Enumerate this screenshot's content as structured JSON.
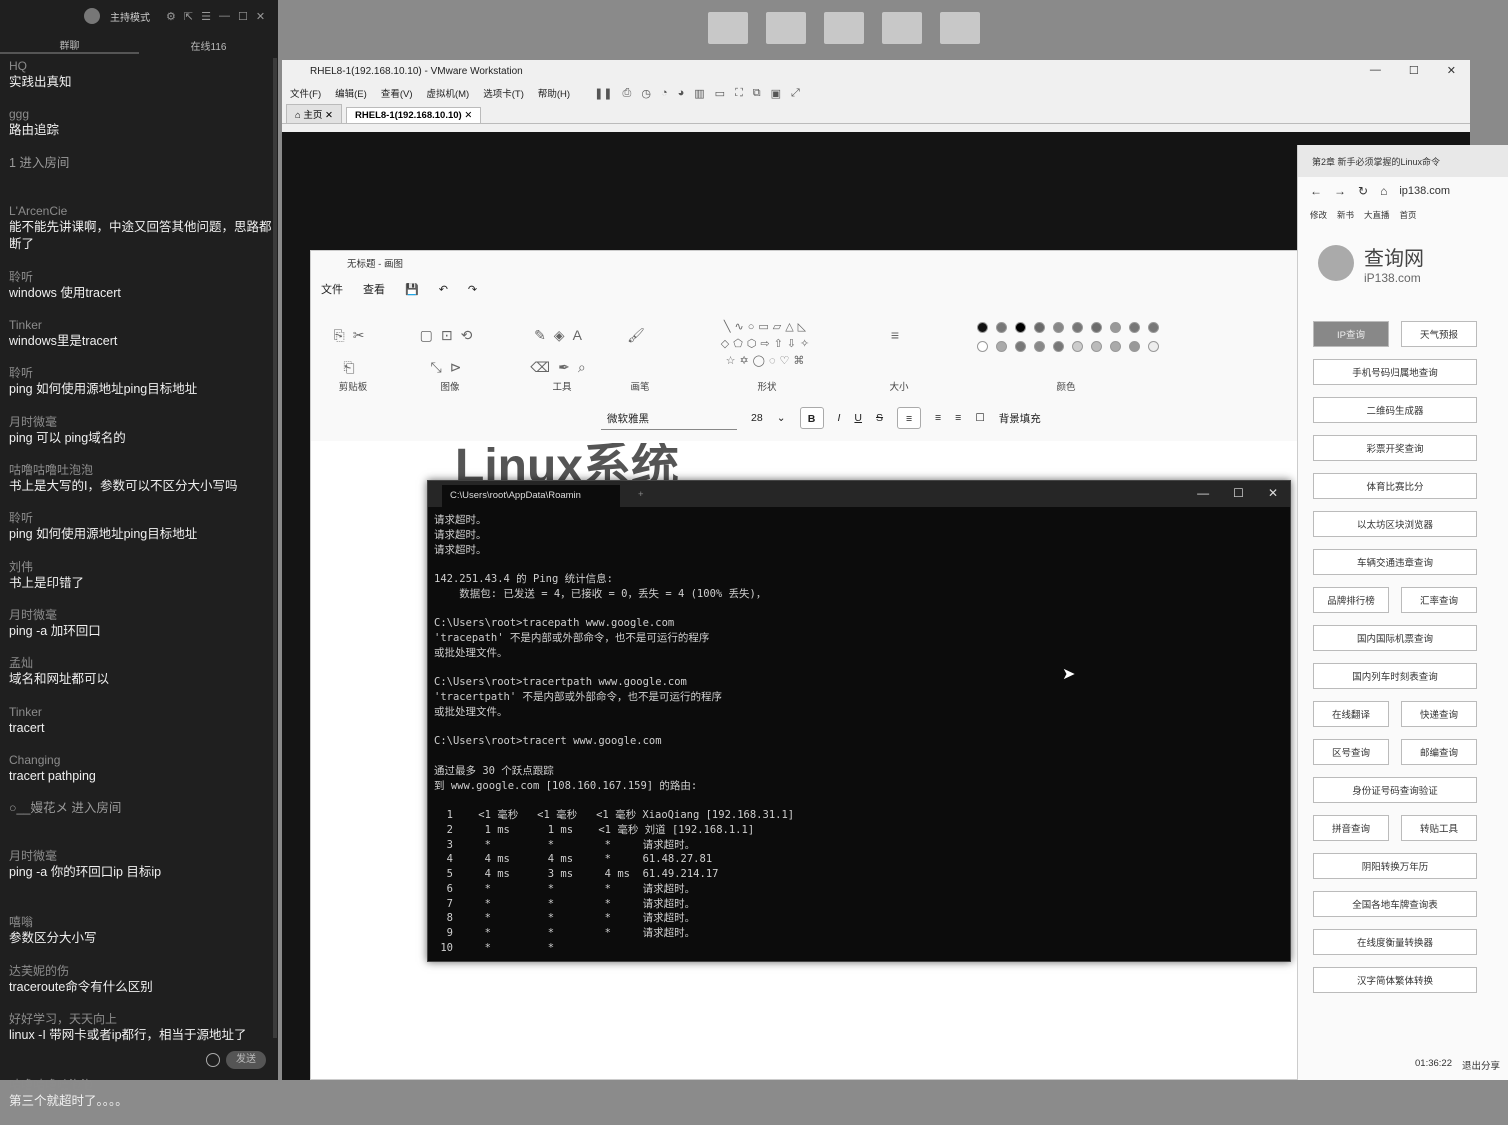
{
  "chat": {
    "mode": "主持模式",
    "tab_chat": "群聊",
    "tab_online": "在线116",
    "send": "发送",
    "messages": [
      {
        "user": "HQ",
        "text": "实践出真知"
      },
      {
        "user": "ggg",
        "text": "路由追踪"
      },
      {
        "user": "",
        "text": "1 进入房间",
        "sys": true
      },
      {
        "user": "L'ArcenCie",
        "text": "能不能先讲课啊，中途又回答其他问题，思路都断了"
      },
      {
        "user": "聆听",
        "text": "windows 使用tracert"
      },
      {
        "user": "Tinker",
        "text": "windows里是tracert"
      },
      {
        "user": "聆听",
        "text": "ping 如何使用源地址ping目标地址"
      },
      {
        "user": "月时微毫",
        "text": "ping 可以 ping域名的"
      },
      {
        "user": "咕噜咕噜吐泡泡",
        "text": "书上是大写的I，参数可以不区分大小写吗"
      },
      {
        "user": "聆听",
        "text": "ping 如何使用源地址ping目标地址"
      },
      {
        "user": "刘伟",
        "text": "书上是印错了"
      },
      {
        "user": "月时微毫",
        "text": "ping -a  加环回口"
      },
      {
        "user": "孟灿",
        "text": "域名和网址都可以"
      },
      {
        "user": "Tinker",
        "text": "tracert"
      },
      {
        "user": "Changing",
        "text": "tracert pathping"
      },
      {
        "user": "",
        "text": "○__嫚花メ    进入房间",
        "sys": true
      },
      {
        "user": "月时微毫",
        "text": "ping  -a  你的环回口ip  目标ip"
      },
      {
        "user": "嘻嗡",
        "text": "参数区分大小写"
      },
      {
        "user": "达芙妮的伤",
        "text": "traceroute命令有什么区别"
      },
      {
        "user": "好好学习，天天向上",
        "text": "linux -I 带网卡或者ip都行，相当于源地址了"
      },
      {
        "user": "咕噜咕噜吐泡泡",
        "text": "第三个就超时了。。。。"
      }
    ]
  },
  "desktop_icons": [
    "",
    "",
    "",
    "",
    ""
  ],
  "vmware": {
    "title": "RHEL8-1(192.168.10.10) - VMware Workstation",
    "menu": [
      "文件(F)",
      "编辑(E)",
      "查看(V)",
      "虚拟机(M)",
      "选项卡(T)",
      "帮助(H)"
    ],
    "tabs": [
      "主页",
      "RHEL8-1(192.168.10.10)"
    ]
  },
  "paint": {
    "title": "无标题 - 画图",
    "menu": [
      "文件",
      "查看"
    ],
    "groups": [
      "剪贴板",
      "图像",
      "工具",
      "画笔",
      "形状",
      "大小",
      "颜色"
    ],
    "font": "微软雅黑",
    "size": "28",
    "fill_label": "背景填充",
    "canvas_text": "Linux系统",
    "colors": [
      "#111111",
      "#777777",
      "#000000",
      "#6a6a6a",
      "#888888",
      "#777777",
      "#6c6c6c",
      "#999999",
      "#777777",
      "#777777",
      "#ffffff",
      "#aaaaaa",
      "#777777",
      "#888888",
      "#777777",
      "#cccccc",
      "#bbbbbb",
      "#aaaaaa",
      "#999999",
      "#eeeeee"
    ]
  },
  "cmd": {
    "tab_title": "C:\\Users\\root\\AppData\\Roamin",
    "output": "请求超时。\n请求超时。\n请求超时。\n\n142.251.43.4 的 Ping 统计信息:\n    数据包: 已发送 = 4，已接收 = 0，丢失 = 4 (100% 丢失)，\n\nC:\\Users\\root>tracepath www.google.com\n'tracepath' 不是内部或外部命令，也不是可运行的程序\n或批处理文件。\n\nC:\\Users\\root>tracertpath www.google.com\n'tracertpath' 不是内部或外部命令，也不是可运行的程序\n或批处理文件。\n\nC:\\Users\\root>tracert www.google.com\n\n通过最多 30 个跃点跟踪\n到 www.google.com [108.160.167.159] 的路由:\n\n  1    <1 毫秒   <1 毫秒   <1 毫秒 XiaoQiang [192.168.31.1]\n  2     1 ms      1 ms    <1 毫秒 刘道 [192.168.1.1]\n  3     *         *        *     请求超时。\n  4     4 ms      4 ms     *     61.48.27.81\n  5     4 ms      3 ms     4 ms  61.49.214.17\n  6     *         *        *     请求超时。\n  7     *         *        *     请求超时。\n  8     *         *        *     请求超时。\n  9     *         *        *     请求超时。\n 10     *         *"
  },
  "browser": {
    "tab": "第2章 新手必须掌握的Linux命令",
    "url": "ip138.com",
    "bookmarks": [
      "修改",
      "新书",
      "大直播",
      "首页"
    ],
    "logo_cn": "查询网",
    "logo_en": "iP138.com",
    "links": [
      [
        "IP查询",
        "天气预报"
      ],
      [
        "手机号码归属地查询"
      ],
      [
        "二维码生成器"
      ],
      [
        "彩票开奖查询"
      ],
      [
        "体育比赛比分"
      ],
      [
        "以太坊区块浏览器"
      ],
      [
        "车辆交通违章查询"
      ],
      [
        "品牌排行榜",
        "汇率查询"
      ],
      [
        "国内国际机票查询"
      ],
      [
        "国内列车时刻表查询"
      ],
      [
        "在线翻译",
        "快递查询"
      ],
      [
        "区号查询",
        "邮编查询"
      ],
      [
        "身份证号码查询验证"
      ],
      [
        "拼音查询",
        "转贴工具"
      ],
      [
        "阴阳转换万年历"
      ],
      [
        "全国各地车牌查询表"
      ],
      [
        "在线度衡量转换器"
      ],
      [
        "汉字简体繁体转换"
      ]
    ],
    "time": "01:36:22",
    "exit": "退出分享"
  }
}
